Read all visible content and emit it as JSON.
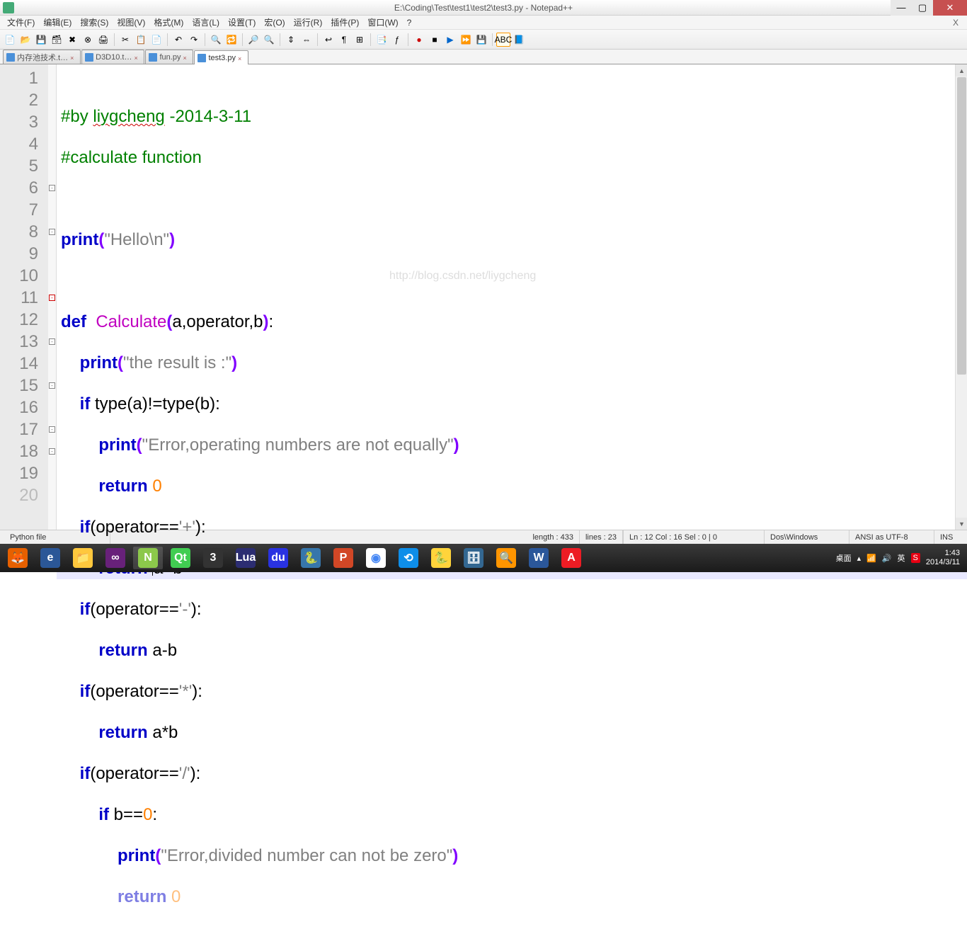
{
  "title": "E:\\Coding\\Test\\test1\\test2\\test3.py - Notepad++",
  "menu": [
    "文件(F)",
    "编辑(E)",
    "搜索(S)",
    "视图(V)",
    "格式(M)",
    "语言(L)",
    "设置(T)",
    "宏(O)",
    "运行(R)",
    "插件(P)",
    "窗口(W)",
    "?"
  ],
  "tabs": [
    {
      "label": "内存池技术.t…",
      "active": false
    },
    {
      "label": "D3D10.t…",
      "active": false
    },
    {
      "label": "fun.py",
      "active": false
    },
    {
      "label": "test3.py",
      "active": true
    }
  ],
  "watermark": "http://blog.csdn.net/liygcheng",
  "status": {
    "filetype": "Python file",
    "length": "length : 433",
    "lines": "lines : 23",
    "pos": "Ln : 12   Col : 16   Sel : 0 | 0",
    "eol": "Dos\\Windows",
    "enc": "ANSI as UTF-8",
    "mode": "INS"
  },
  "tray": {
    "desktop": "桌面",
    "ime": "英",
    "time": "1:43",
    "date": "2014/3/11"
  },
  "code": {
    "l1_a": "#by ",
    "l1_b": "liygcheng",
    "l1_c": " -2014-3-11",
    "l2": "#calculate function",
    "l4_kw": "print",
    "l4_s": "\"Hello\\n\"",
    "l6_def": "def",
    "l6_fn": "Calculate",
    "l6_args": "a,operator,b",
    "l7_kw": "print",
    "l7_s": "\"the result is :\"",
    "l8_if": "if",
    "l8_body": " type(a)!=type(b):",
    "l9_kw": "print",
    "l9_s": "\"Error,operating numbers are not equally\"",
    "l10_kw": "return",
    "l10_n": "0",
    "l11_if": "if",
    "l11_body": "(operator==",
    "l11_s": "'+'",
    "l11_end": "):",
    "l12_kw": "return",
    "l12_body": " a+b",
    "l13_if": "if",
    "l13_body": "(operator==",
    "l13_s": "'-'",
    "l13_end": "):",
    "l14_kw": "return",
    "l14_body": " a-b",
    "l15_if": "if",
    "l15_body": "(operator==",
    "l15_s": "'*'",
    "l15_end": "):",
    "l16_kw": "return",
    "l16_body": " a*b",
    "l17_if": "if",
    "l17_body": "(operator==",
    "l17_s": "'/'",
    "l17_end": "):",
    "l18_if": "if",
    "l18_body": " b==",
    "l18_n": "0",
    "l18_end": ":",
    "l19_kw": "print",
    "l19_s": "\"Error,divided number can not be zero\"",
    "l20_kw": "return",
    "l20_n": "0"
  }
}
